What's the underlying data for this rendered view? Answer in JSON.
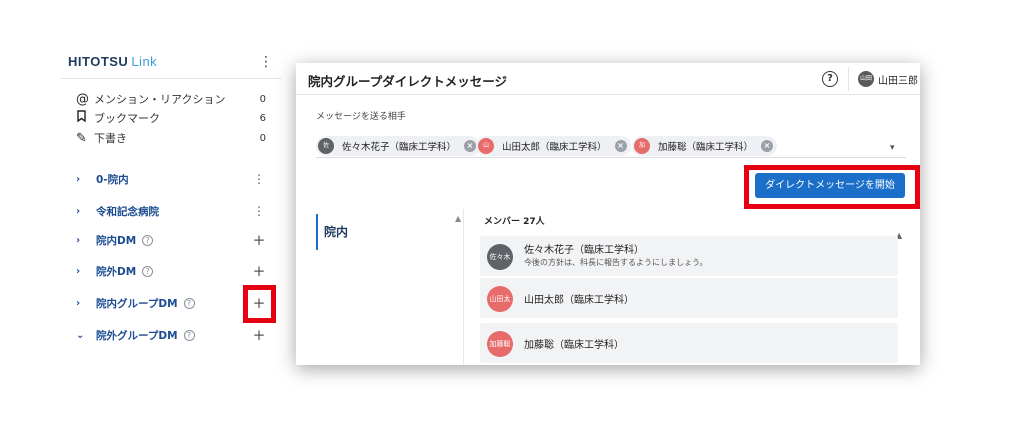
{
  "sidebar": {
    "logo_main": "HITOTSU",
    "logo_link": "Link",
    "quick_items": [
      {
        "icon": "@",
        "label": "メンション・リアクション",
        "count": "0"
      },
      {
        "icon": "🔖",
        "label": "ブックマーク",
        "count": "6"
      },
      {
        "icon": "✎",
        "label": "下書き",
        "count": "0"
      }
    ],
    "groups": [
      {
        "label": "0-院内",
        "chevron": "›",
        "help": false,
        "action": "⋮"
      },
      {
        "label": "令和記念病院",
        "chevron": "›",
        "help": false,
        "action": "⋮"
      },
      {
        "label": "院内DM",
        "chevron": "›",
        "help": true,
        "action": "+"
      },
      {
        "label": "院外DM",
        "chevron": "›",
        "help": true,
        "action": "+"
      },
      {
        "label": "院内グループDM",
        "chevron": "›",
        "help": true,
        "action": "+"
      },
      {
        "label": "院外グループDM",
        "chevron": "⌄",
        "help": true,
        "action": "+"
      }
    ],
    "highlight_color": "#e60012"
  },
  "panel": {
    "title": "院内グループダイレクトメッセージ",
    "help": "?",
    "user": {
      "avatar": "山田",
      "name": "山田三郎"
    },
    "recipients_label": "メッセージを送る相手",
    "chips": [
      {
        "avatar": "佐",
        "name": "佐々木花子（臨床工学科）",
        "color": "#5f6368"
      },
      {
        "avatar": "山",
        "name": "山田太郎（臨床工学科）",
        "color": "#e86b6b"
      },
      {
        "avatar": "加",
        "name": "加藤聡（臨床工学科）",
        "color": "#e86b6b"
      }
    ],
    "remove_icon": "×",
    "dropdown_icon": "▾",
    "start_button": "ダイレクトメッセージを開始",
    "tab": "院内",
    "members_label": "メンバー 27人",
    "members": [
      {
        "avatar": "佐々木",
        "name": "佐々木花子（臨床工学科）",
        "message": "今後の方針は、科長に報告するようにしましょう。",
        "color": "#5f6368"
      },
      {
        "avatar": "山田太",
        "name": "山田太郎（臨床工学科）",
        "message": "",
        "color": "#e86b6b"
      },
      {
        "avatar": "加藤聡",
        "name": "加藤聡（臨床工学科）",
        "message": "",
        "color": "#e86b6b"
      }
    ],
    "primary_color": "#1b6fc9"
  }
}
